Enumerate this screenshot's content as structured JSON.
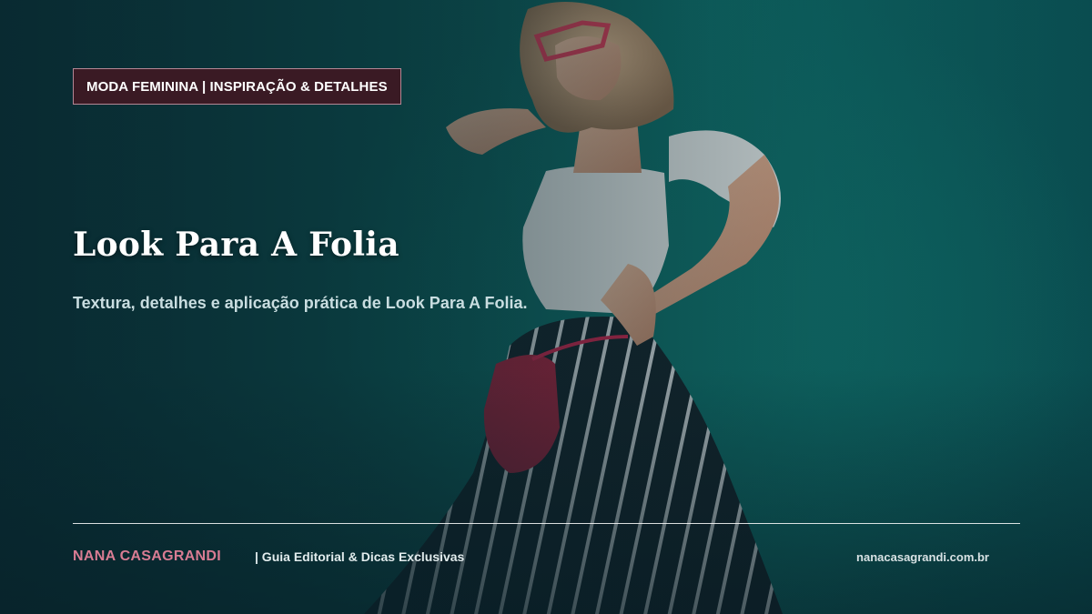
{
  "hero": {
    "category_tag": "MODA FEMININA | INSPIRAÇÃO & DETALHES",
    "title": "Look Para A Folia",
    "subtitle": "Textura, detalhes e aplicação prática de Look Para A Folia."
  },
  "footer": {
    "brand": "NANA CASAGRANDI",
    "tagline": "|  Guia Editorial & Dicas Exclusivas",
    "website": "nanacasagrandi.com.br"
  },
  "colors": {
    "background_teal": "#0e6b67",
    "tag_background": "#3a1a24",
    "brand_pink": "#d87c93",
    "bag_red": "#a0213c"
  }
}
